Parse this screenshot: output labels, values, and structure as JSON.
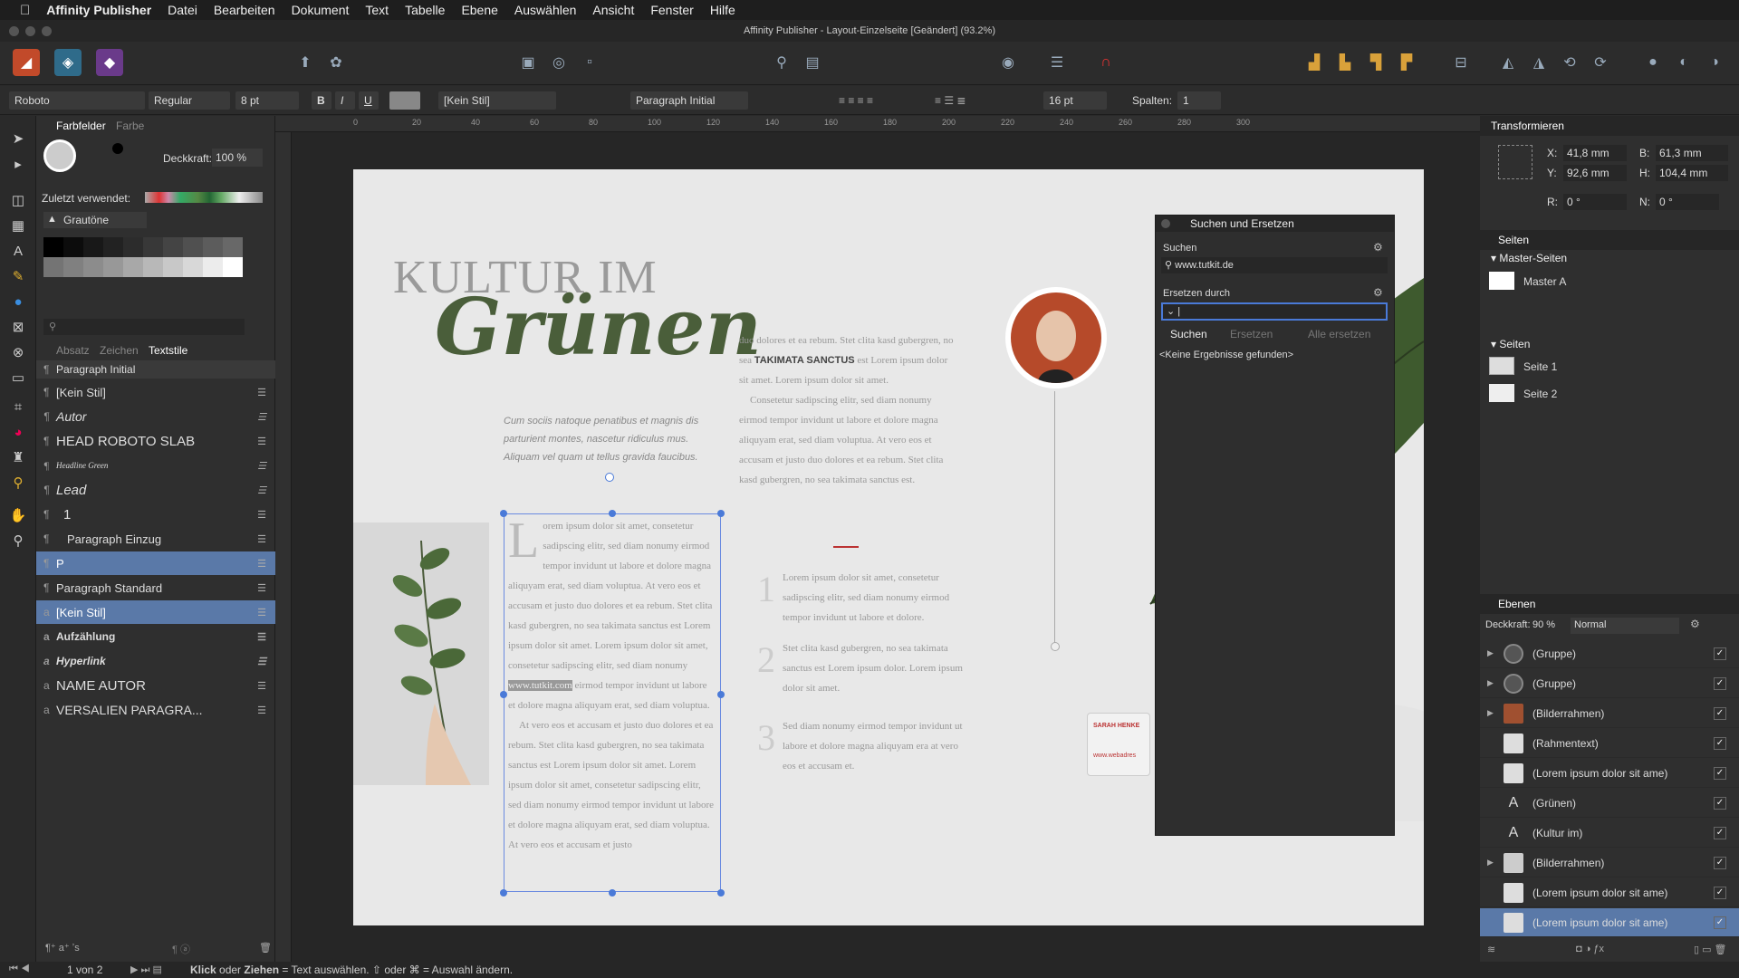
{
  "menubar": {
    "app": "Affinity Publisher",
    "items": [
      "Datei",
      "Bearbeiten",
      "Dokument",
      "Text",
      "Tabelle",
      "Ebene",
      "Auswählen",
      "Ansicht",
      "Fenster",
      "Hilfe"
    ]
  },
  "window": {
    "title": "Affinity Publisher - Layout-Einzelseite [Geändert] (93.2%)"
  },
  "context": {
    "font": "Roboto",
    "weight": "Regular",
    "size": "8 pt",
    "char_style": "[Kein Stil]",
    "para_style": "Paragraph Initial",
    "leading": "16 pt",
    "columns_label": "Spalten:",
    "columns": "1"
  },
  "swatches": {
    "tab_active": "Farbfelder",
    "tab_other": "Farbe",
    "opacity_label": "Deckkraft:",
    "opacity": "100 %",
    "recent_label": "Zuletzt verwendet:",
    "palette": "Grautöne"
  },
  "textstyles": {
    "tabs": [
      "Absatz",
      "Zeichen",
      "Textstile"
    ],
    "items": [
      {
        "label": "Paragraph Initial",
        "icon": "¶"
      },
      {
        "label": "[Kein Stil]",
        "icon": "¶"
      },
      {
        "label": "Autor",
        "icon": "¶"
      },
      {
        "label": "HEAD ROBOTO SLAB",
        "icon": "¶"
      },
      {
        "label": "Headline Green",
        "icon": "¶"
      },
      {
        "label": "Lead",
        "icon": "¶"
      },
      {
        "label": "1",
        "icon": "¶"
      },
      {
        "label": "Paragraph Einzug",
        "icon": "¶"
      },
      {
        "label": "P",
        "icon": "¶"
      },
      {
        "label": "Paragraph Standard",
        "icon": "¶"
      },
      {
        "label": "[Kein Stil]",
        "icon": "a"
      },
      {
        "label": "Aufzählung",
        "icon": "a"
      },
      {
        "label": "Hyperlink",
        "icon": "a"
      },
      {
        "label": "NAME AUTOR",
        "icon": "a"
      },
      {
        "label": "VERSALIEN PARAGRA...",
        "icon": "a"
      }
    ]
  },
  "transform": {
    "title": "Transformieren",
    "x_label": "X:",
    "x": "41,8 mm",
    "y_label": "Y:",
    "y": "92,6 mm",
    "b_label": "B:",
    "b": "61,3 mm",
    "h_label": "H:",
    "h": "104,4 mm",
    "r_label": "R:",
    "r": "0 °",
    "n_label": "N:",
    "n": "0 °"
  },
  "pages": {
    "title": "Seiten",
    "master_title": "Master-Seiten",
    "master": "Master A",
    "pages_title": "Seiten",
    "items": [
      "Seite 1",
      "Seite 2"
    ]
  },
  "layers": {
    "title": "Ebenen",
    "opacity_label": "Deckkraft:",
    "opacity": "90 %",
    "blend": "Normal",
    "items": [
      "(Gruppe)",
      "(Gruppe)",
      "(Bilderrahmen)",
      "(Rahmentext)",
      "(Lorem ipsum dolor sit ame)",
      "(Grünen)",
      "(Kultur im)",
      "(Bilderrahmen)",
      "(Lorem ipsum dolor sit ame)",
      "(Lorem ipsum dolor sit ame)"
    ]
  },
  "find": {
    "title": "Suchen und Ersetzen",
    "search_label": "Suchen",
    "search_value": "www.tutkit.de",
    "replace_label": "Ersetzen durch",
    "btn_find": "Suchen",
    "btn_replace": "Ersetzen",
    "btn_replace_all": "Alle ersetzen",
    "result": "<Keine Ergebnisse gefunden>"
  },
  "doc": {
    "head1": "KULTUR IM",
    "head2": "Grünen",
    "lead": "Cum sociis natoque penatibus et magnis dis parturient montes, nascetur ridiculus mus. Aliquam vel quam ut tellus gravida faucibus.",
    "col_text": "orem ipsum dolor sit amet, consetetur sadipscing elitr, sed diam nonumy eirmod tempor invidunt ut labore et dolore magna aliquyam erat, sed diam voluptua. At vero eos et accusam et justo duo dolores et ea rebum. Stet clita kasd gubergren, no sea takimata sanctus est Lorem ipsum dolor sit amet. Lorem ipsum dolor sit amet, consetetur sadipscing elitr, sed diam nonumy",
    "url": "www.tutkit.com",
    "col_text2": "eirmod tempor invidunt ut labore et dolore magna aliquyam erat, sed diam voluptua.",
    "col_text3": "At vero eos et accusam et justo duo dolores et ea rebum. Stet clita kasd gubergren, no sea takimata sanctus est Lorem ipsum dolor sit amet. Lorem ipsum dolor sit amet, consetetur sadipscing elitr, sed diam nonumy eirmod tempor invidunt ut labore et dolore magna aliquyam erat, sed diam voluptua. At vero eos et accusam et justo",
    "right_text1": "duo dolores et ea rebum. Stet clita kasd gubergren, no sea",
    "right_bold": "TAKIMATA SANCTUS",
    "right_text2": "est Lorem ipsum dolor sit amet. Lorem ipsum dolor sit amet.",
    "right_text3": "Consetetur sadipscing elitr, sed diam nonumy eirmod tempor invidunt ut labore et dolore magna aliquyam erat, sed diam voluptua. At vero eos et accusam et justo duo dolores et ea rebum. Stet clita kasd gubergren, no sea takimata sanctus est.",
    "num1": "1",
    "num1_text": "Lorem ipsum dolor sit amet, consetetur sadipscing elitr, sed diam nonumy eirmod tempor invidunt ut labore et dolore.",
    "num2": "2",
    "num2_text": "Stet clita kasd gubergren, no sea takimata sanctus est Lorem ipsum dolor. Lorem ipsum dolor sit amet.",
    "num3": "3",
    "num3_text": "Sed diam nonumy eirmod tempor invidunt ut labore et dolore magna aliquyam era at vero eos et accusam et.",
    "card_name": "SARAH HENKE",
    "card_web": "www.webadres"
  },
  "status": {
    "page": "1 von 2",
    "hint_bold1": "Klick",
    "hint_mid": "oder",
    "hint_bold2": "Ziehen",
    "hint_rest": "= Text auswählen. ⇧ oder ⌘ = Auswahl ändern."
  },
  "ruler": [
    "0",
    "20",
    "40",
    "60",
    "80",
    "100",
    "120",
    "140",
    "160",
    "180",
    "200",
    "220",
    "240",
    "260",
    "280",
    "300"
  ]
}
